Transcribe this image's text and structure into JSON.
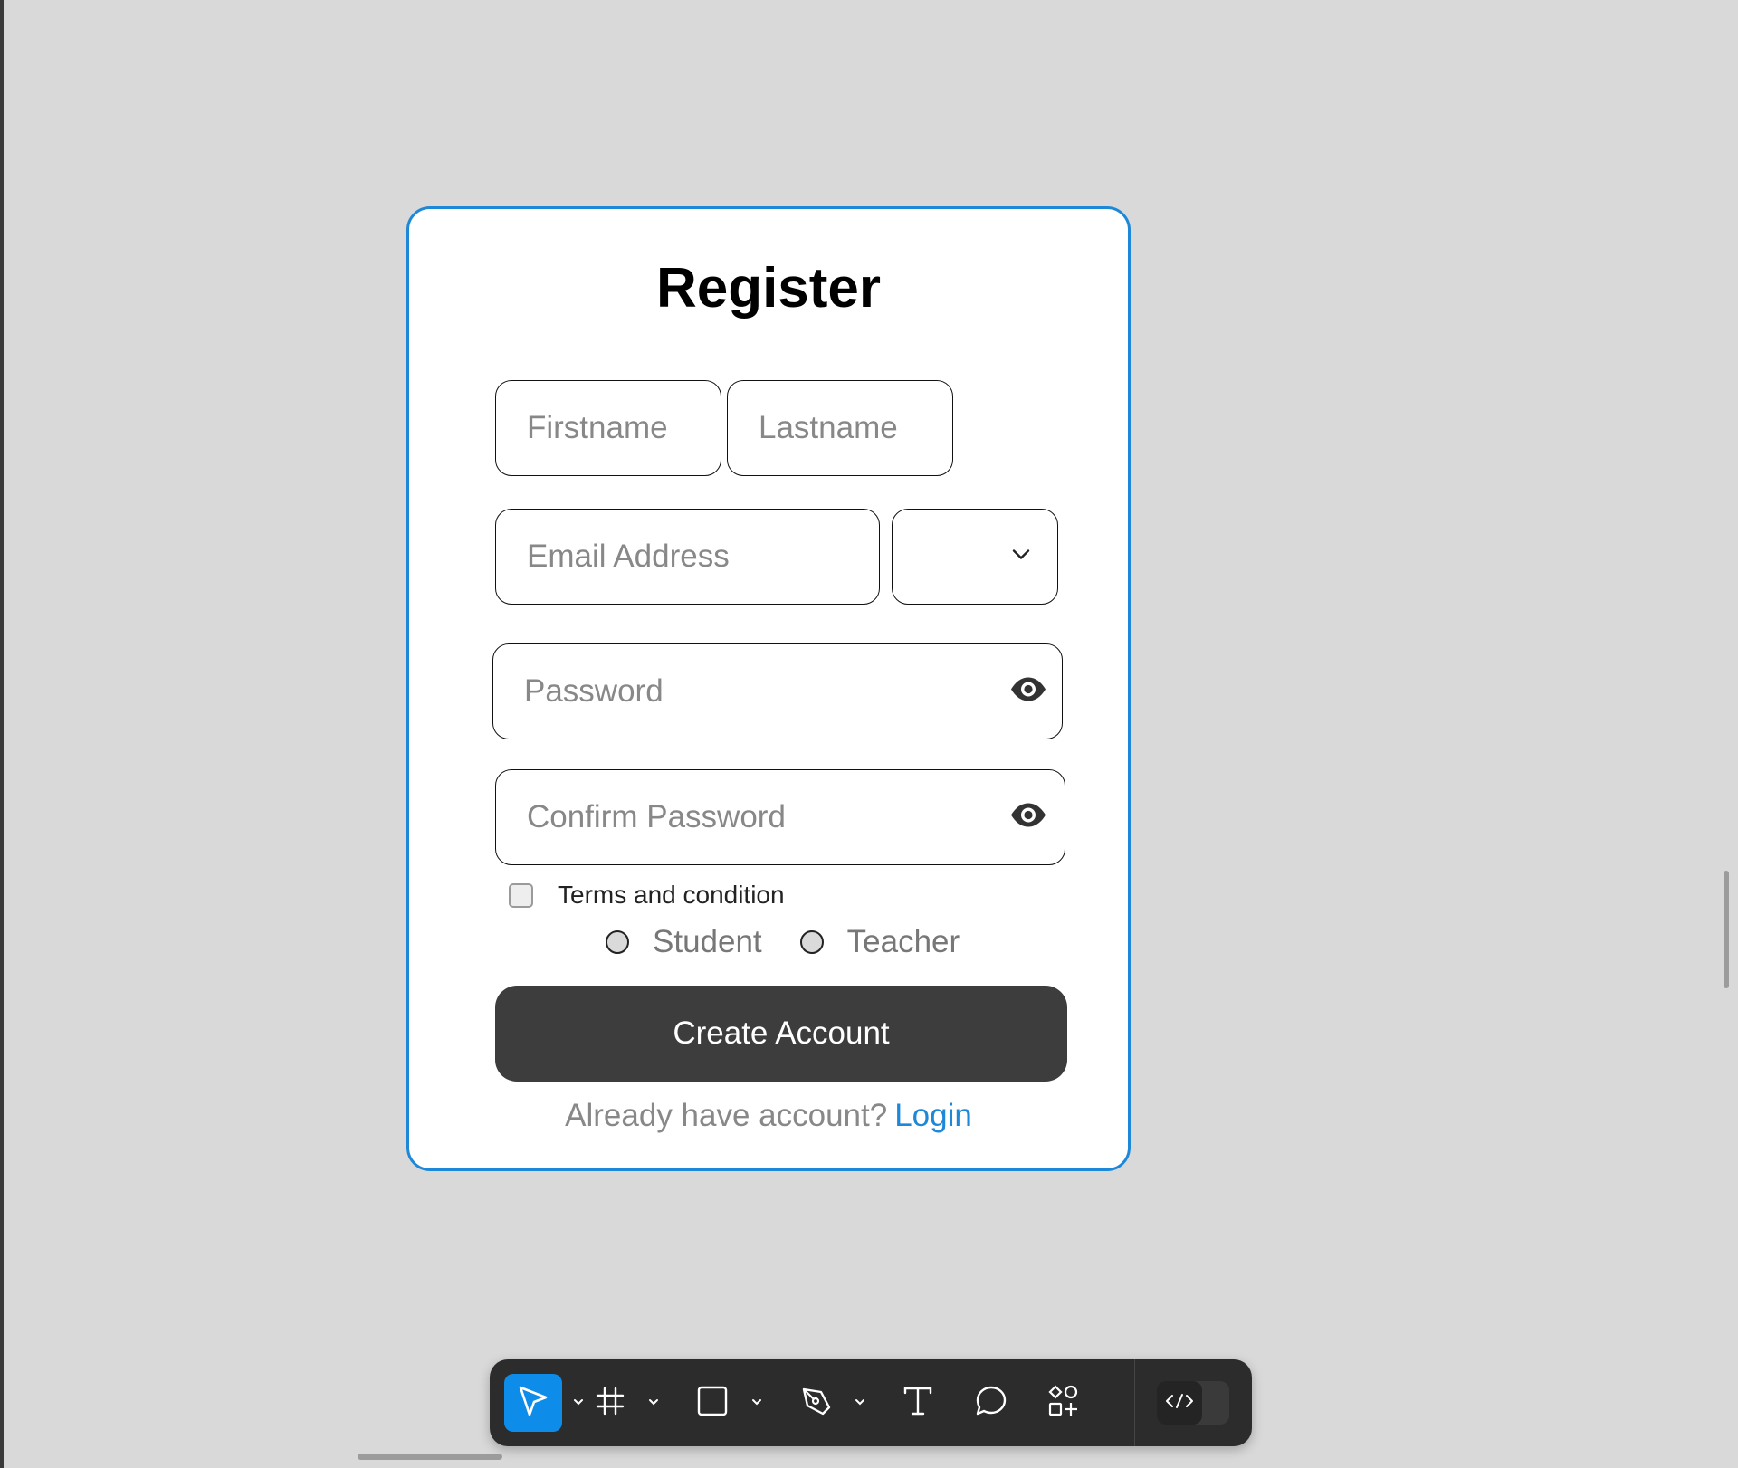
{
  "form": {
    "title": "Register",
    "firstname_placeholder": "Firstname",
    "lastname_placeholder": "Lastname",
    "email_placeholder": "Email Address",
    "select_value": "",
    "password_placeholder": "Password",
    "confirm_password_placeholder": "Confirm Password",
    "terms_label": "Terms and condition",
    "roles": [
      {
        "label": "Student"
      },
      {
        "label": "Teacher"
      }
    ],
    "create_button_label": "Create Account",
    "login_prompt": "Already have account?",
    "login_link_label": "Login"
  },
  "colors": {
    "canvas": "#d9d9d9",
    "accent": "#1e88d8",
    "button": "#3d3d3d",
    "toolbar": "#2c2c2c",
    "toolbar_active": "#0d8ce9"
  },
  "toolbar": {
    "tools": [
      "move-icon",
      "frame-icon",
      "rectangle-icon",
      "pen-icon",
      "text-icon",
      "comment-icon",
      "actions-icon"
    ],
    "dev_mode_icon": "code-icon"
  }
}
